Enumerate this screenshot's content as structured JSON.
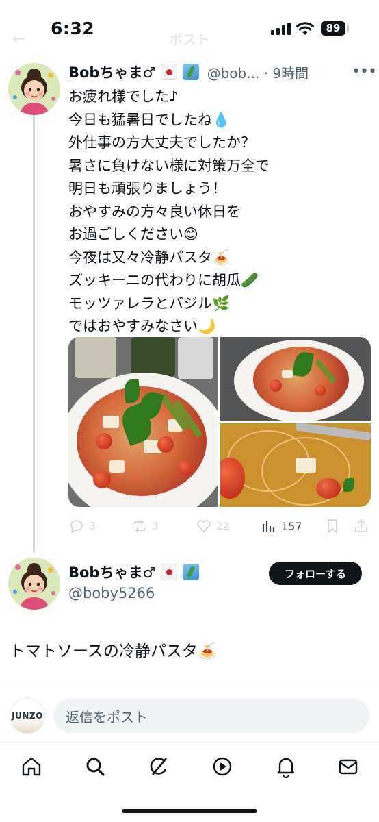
{
  "status_bar": {
    "time": "6:32",
    "battery": "89"
  },
  "header": {
    "title": "ポスト"
  },
  "tweet": {
    "display_name": "Bobちゃま♂",
    "handle_time": "@bob... · 9時間",
    "lines": [
      "お疲れ様でした♪",
      "今日も猛暑日でしたね💧",
      "外仕事の方大丈夫でしたか？",
      "暑さに負けない様に対策万全で",
      "明日も頑張りましょう！",
      "おやすみの方々良い休日を",
      "お過ごしください😊",
      "今夜は又々冷静パスタ🍝",
      "ズッキーニの代わりに胡瓜🥒",
      "モッツァレラとバジル🌿",
      "ではおやすみなさい🌙"
    ],
    "replies": "3",
    "reposts": "3",
    "likes": "22",
    "views": "157"
  },
  "main_post": {
    "display_name": "Bobちゃま♂",
    "handle": "@boby5266",
    "follow_label": "フォローする",
    "text": "トマトソースの冷静パスタ🍝"
  },
  "reply": {
    "avatar_text": "JUNZO",
    "placeholder": "返信をポスト"
  },
  "icons": {
    "tabs": [
      "home-icon",
      "search-icon",
      "grok-icon",
      "video-icon",
      "notifications-icon",
      "messages-icon"
    ]
  },
  "colors": {
    "text": "#0f1419",
    "secondary": "#536471",
    "follow_button": "#0f1419",
    "thread_line": "#cfd9de"
  }
}
